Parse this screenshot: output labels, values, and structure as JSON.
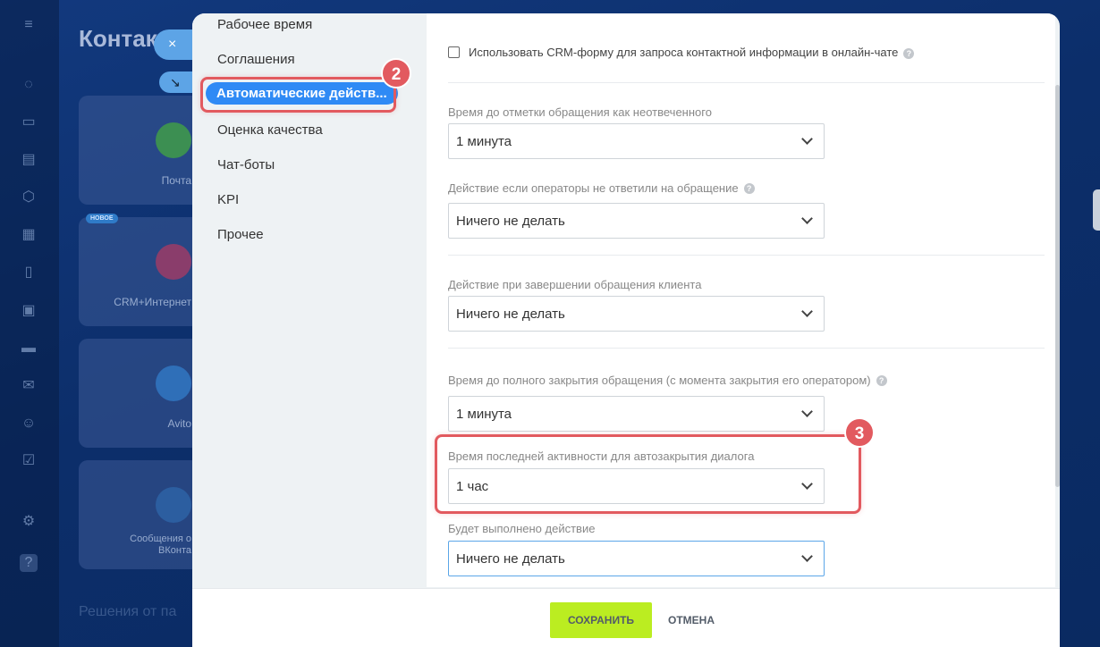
{
  "background": {
    "title": "Контакт",
    "badge_new": "НОВОЕ",
    "cards": [
      {
        "label": "Почта"
      },
      {
        "label": "CRM+Интернет"
      },
      {
        "label": "Avito"
      },
      {
        "label": "Сообщения о\nВКонта"
      }
    ],
    "footer_text": "Решения от па"
  },
  "window": {
    "close_icon": "×",
    "minimize_icon": "↘"
  },
  "nav": {
    "items": [
      {
        "label": "Рабочее время"
      },
      {
        "label": "Соглашения"
      },
      {
        "label": "Автоматические действ..."
      },
      {
        "label": "Оценка качества"
      },
      {
        "label": "Чат-боты"
      },
      {
        "label": "KPI"
      },
      {
        "label": "Прочее"
      }
    ],
    "active_index": 2
  },
  "annotations": {
    "step2": "2",
    "step3": "3",
    "highlight_color": "#e25a5f"
  },
  "form": {
    "crm_form_checkbox_label": "Использовать CRM-форму для запроса контактной информации в онлайн-чате",
    "fields": [
      {
        "label": "Время до отметки обращения как неотвеченного",
        "value": "1 минута",
        "help": false
      },
      {
        "label": "Действие если операторы не ответили на обращение",
        "value": "Ничего не делать",
        "help": true
      },
      {
        "label": "Действие при завершении обращения клиента",
        "value": "Ничего не делать",
        "help": false
      },
      {
        "label": "Время до полного закрытия обращения (с момента закрытия его оператором)",
        "value": "1 минута",
        "help": true
      },
      {
        "label": "Время последней активности для автозакрытия диалога",
        "value": "1 час",
        "help": false
      },
      {
        "label": "Будет выполнено действие",
        "value": "Ничего не делать",
        "help": false
      }
    ]
  },
  "footer": {
    "save_label": "СОХРАНИТЬ",
    "cancel_label": "ОТМЕНА",
    "save_color": "#bbed21"
  }
}
